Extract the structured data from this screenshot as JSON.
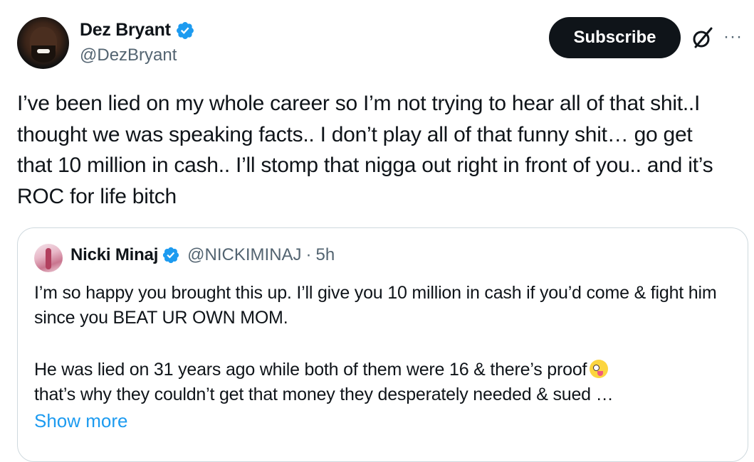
{
  "author": {
    "display_name": "Dez Bryant",
    "handle": "@DezBryant",
    "verified": true
  },
  "actions": {
    "subscribe_label": "Subscribe",
    "grok_icon": "grok-icon",
    "more_icon": "more-icon",
    "more_glyph": "···"
  },
  "tweet": {
    "text": "I’ve been lied on my whole career so I’m not trying to hear all of that shit..I thought we was speaking facts.. I don’t play all of that funny shit… go get that 10 million in cash.. I’ll stomp that nigga out right in front of you.. and it’s ROC for life bitch"
  },
  "quoted_tweet": {
    "display_name": "Nicki Minaj",
    "handle": "@NICKIMINAJ",
    "separator": "·",
    "time": "5h",
    "verified": true,
    "paragraph_1": "I’m so happy you brought this up. I’ll give you 10 million in cash if you’d come & fight him since you BEAT UR OWN MOM.",
    "paragraph_2_line_1": "He was lied on 31 years ago while both of them were 16 & there’s proof",
    "paragraph_2_line_2": "that’s why they couldn’t get that money they desperately needed & sued …",
    "emoji": "zany-face-emoji",
    "show_more_label": "Show more"
  },
  "colors": {
    "text_primary": "#0f1419",
    "text_secondary": "#536471",
    "accent_blue": "#1d9bf0",
    "border": "#cfd9de",
    "button_bg": "#0f1419"
  }
}
